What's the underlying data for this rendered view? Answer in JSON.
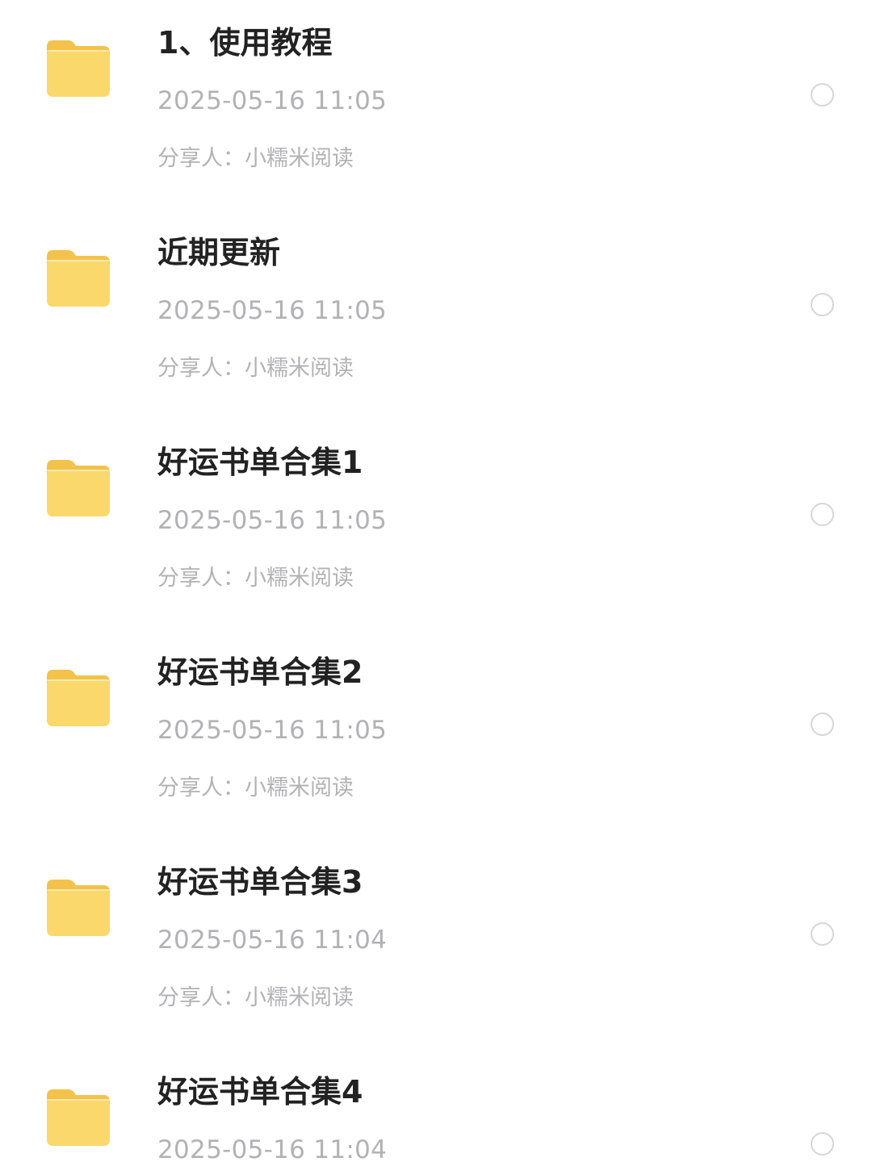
{
  "file_list": {
    "items": [
      {
        "name": "1、使用教程",
        "date": "2025-05-16 11:05",
        "sharer": "分享人：小糯米阅读",
        "selected": false
      },
      {
        "name": "近期更新",
        "date": "2025-05-16 11:05",
        "sharer": "分享人：小糯米阅读",
        "selected": false
      },
      {
        "name": "好运书单合集1",
        "date": "2025-05-16 11:05",
        "sharer": "分享人：小糯米阅读",
        "selected": false
      },
      {
        "name": "好运书单合集2",
        "date": "2025-05-16 11:05",
        "sharer": "分享人：小糯米阅读",
        "selected": false
      },
      {
        "name": "好运书单合集3",
        "date": "2025-05-16 11:04",
        "sharer": "分享人：小糯米阅读",
        "selected": false
      },
      {
        "name": "好运书单合集4",
        "date": "2025-05-16 11:04",
        "sharer": "",
        "selected": false
      }
    ]
  },
  "colors": {
    "folder_back": "#F3C24A",
    "folder_front": "#FAD86B",
    "title_text": "#222222",
    "meta_text": "#B2B2B6",
    "select_border": "#D6D6DA"
  },
  "icons": {
    "folder": "folder-icon",
    "select": "select-circle-icon"
  }
}
